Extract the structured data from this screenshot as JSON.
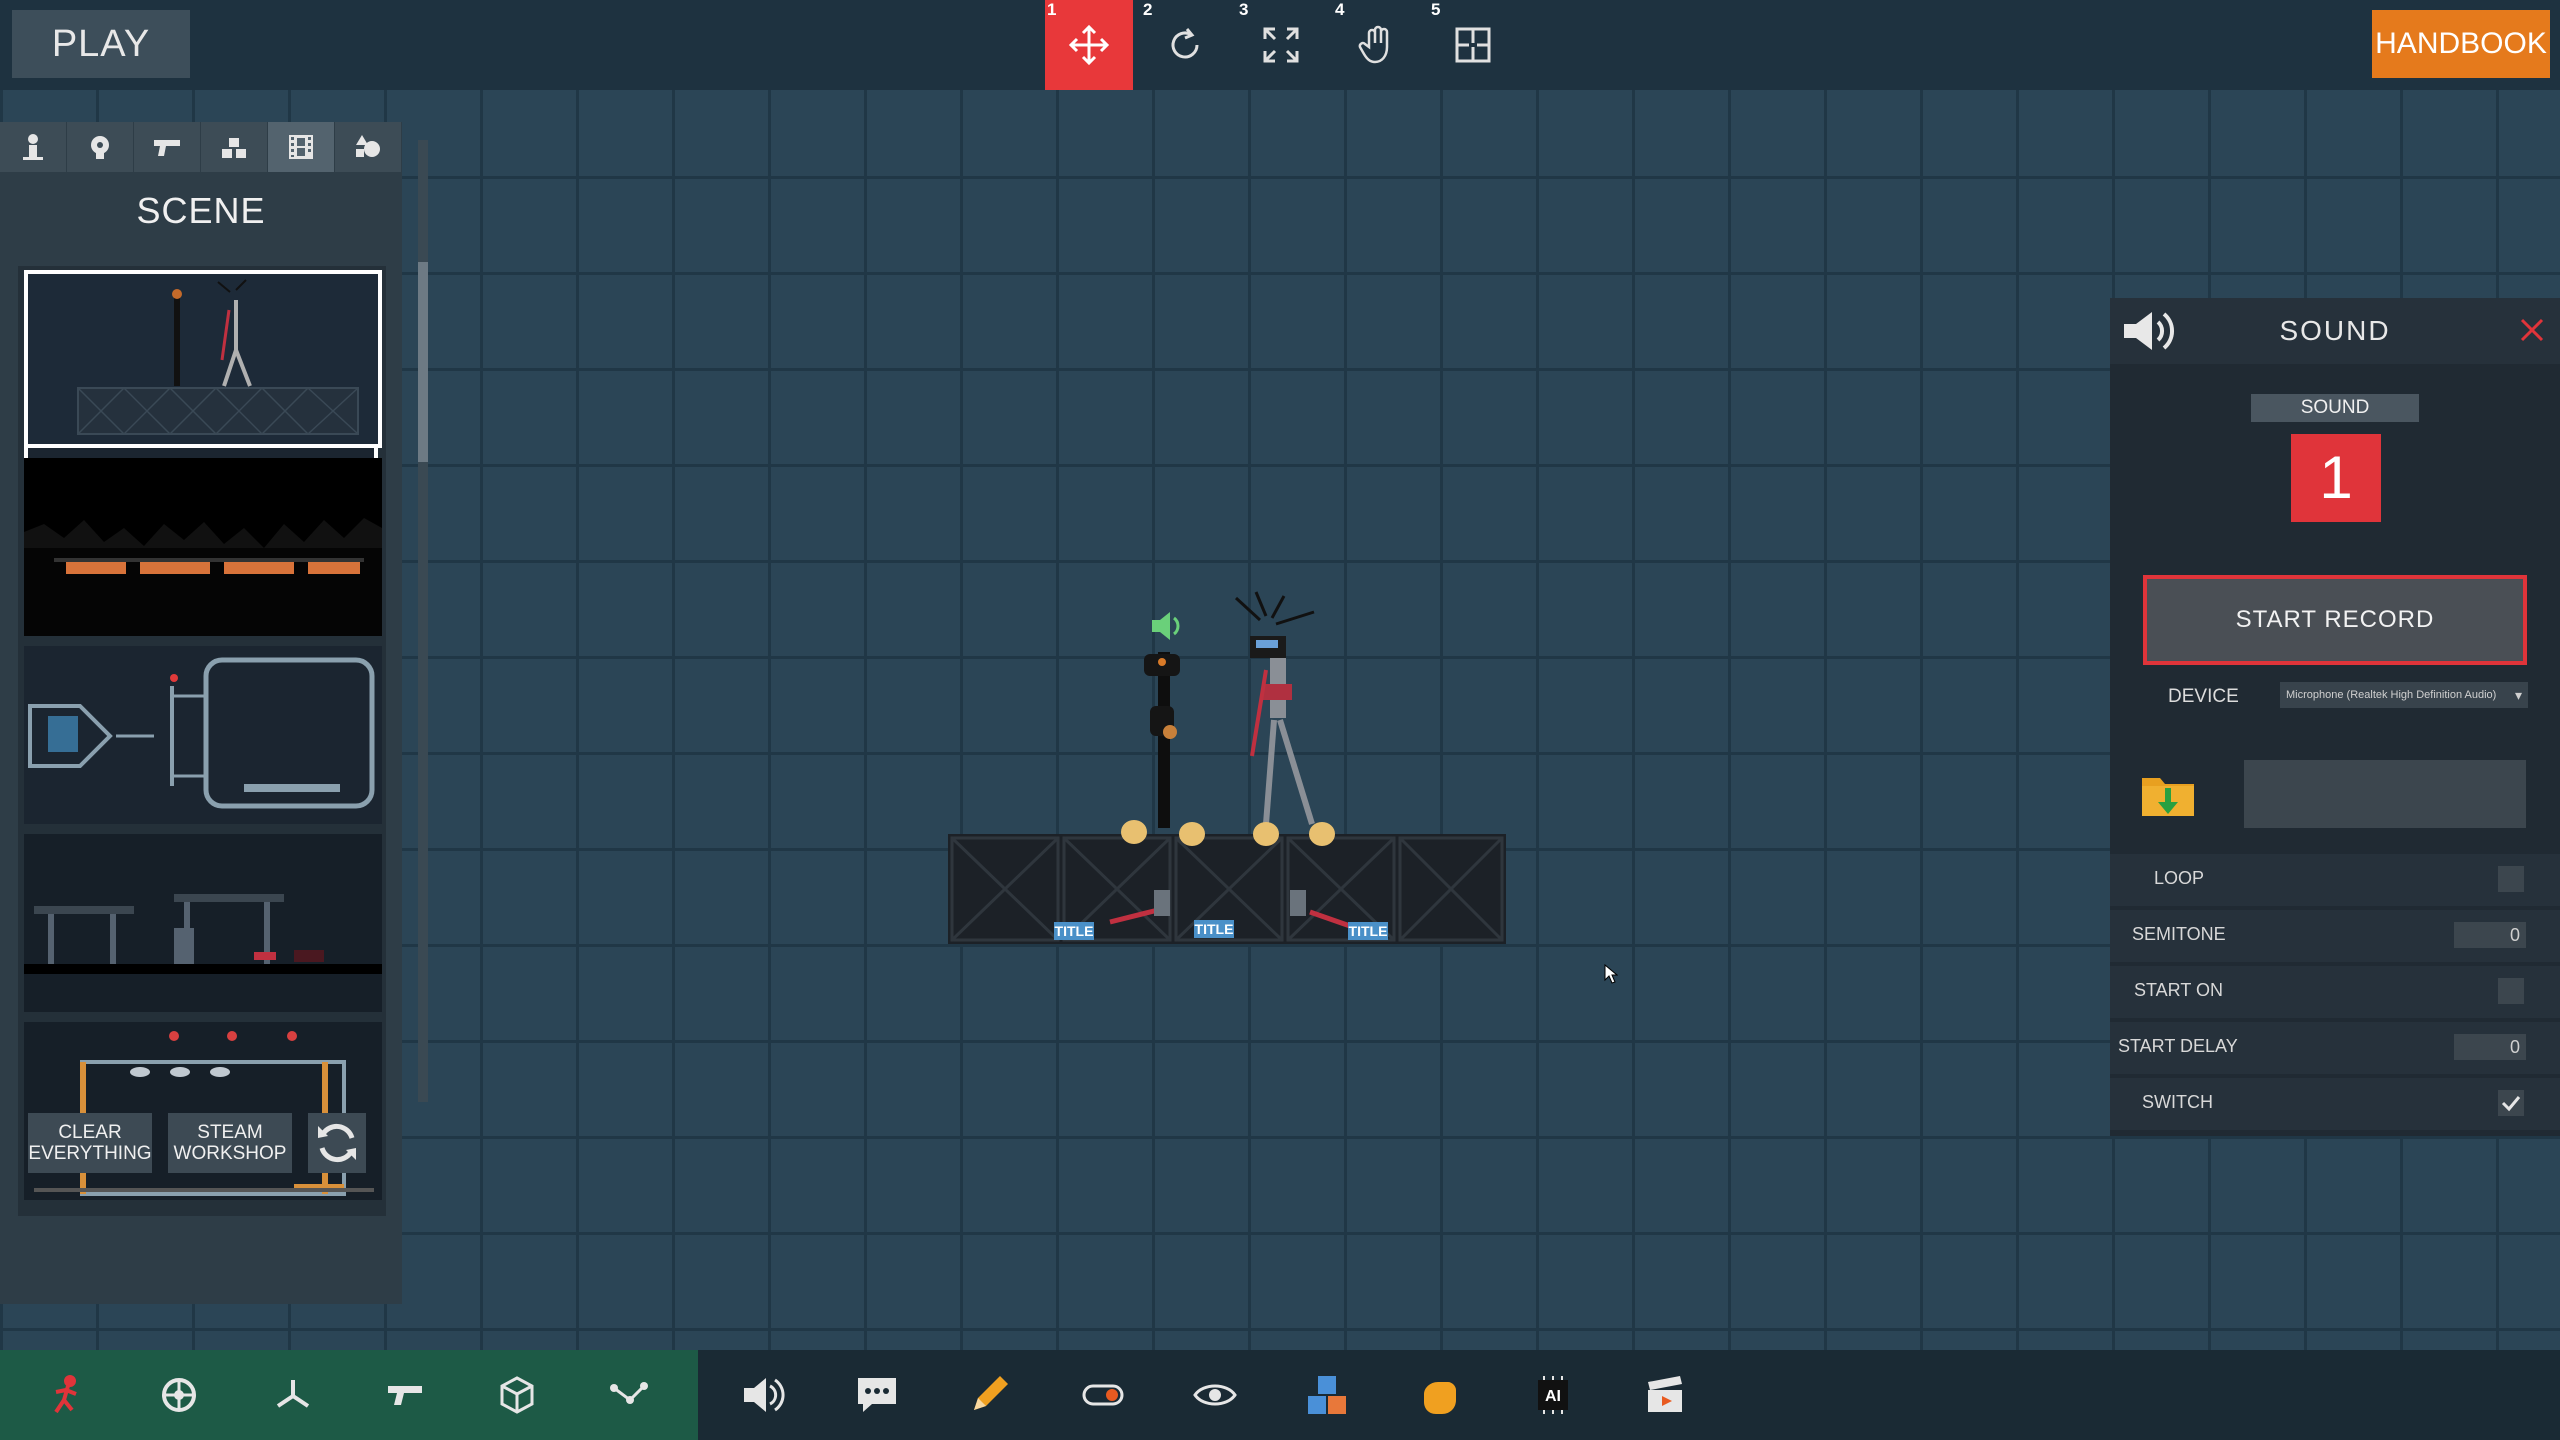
{
  "topbar": {
    "play_label": "PLAY",
    "handbook_label": "HANDBOOK",
    "tools": [
      {
        "num": "1",
        "icon": "move-icon",
        "active": true
      },
      {
        "num": "2",
        "icon": "rotate-icon",
        "active": false
      },
      {
        "num": "3",
        "icon": "scale-icon",
        "active": false
      },
      {
        "num": "4",
        "icon": "hand-icon",
        "active": false
      },
      {
        "num": "5",
        "icon": "snap-icon",
        "active": false
      }
    ]
  },
  "sidebar": {
    "title": "SCENE",
    "category_tabs": [
      "person-icon",
      "biohazard-icon",
      "gun-icon",
      "blocks-icon",
      "film-icon",
      "shapes-icon"
    ],
    "clear_label_1": "CLEAR",
    "clear_label_2": "EVERYTHING",
    "steam_label_1": "STEAM",
    "steam_label_2": "WORKSHOP"
  },
  "sound_panel": {
    "title": "SOUND",
    "sound_label": "SOUND",
    "sound_number": "1",
    "record_label": "START RECORD",
    "device_label": "DEVICE",
    "device_value": "Microphone (Realtek High Definition Audio)",
    "rows": {
      "loop": {
        "label": "LOOP"
      },
      "semitone": {
        "label": "SEMITONE",
        "value": "0"
      },
      "start_on": {
        "label": "START ON"
      },
      "start_delay": {
        "label": "START DELAY",
        "value": "0"
      },
      "switch": {
        "label": "SWITCH",
        "checked": true
      }
    }
  },
  "scene": {
    "crate_labels": [
      "TITLE",
      "TITLE",
      "TITLE"
    ]
  },
  "colors": {
    "accent_red": "#e0343a",
    "handbook_orange": "#e57a1c",
    "grid_bg": "#2b4556"
  }
}
